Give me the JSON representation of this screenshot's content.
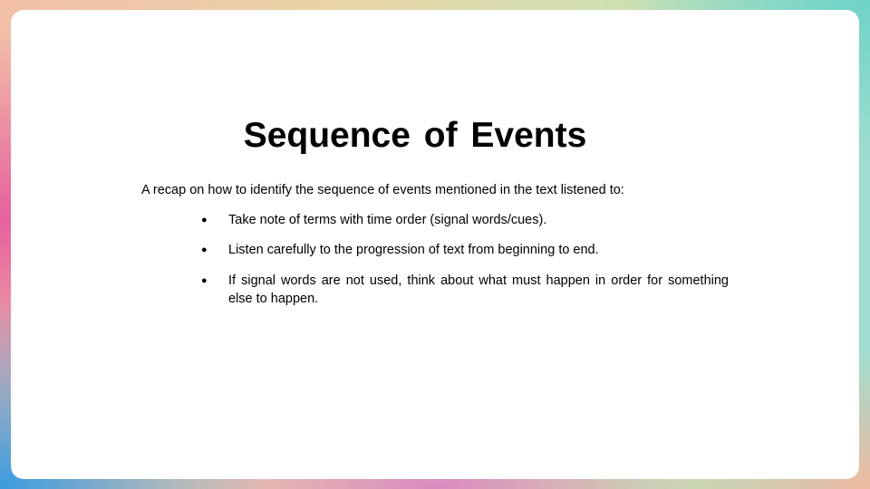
{
  "slide": {
    "title": "Sequence of Events",
    "intro": "A recap on how to identify the sequence of events mentioned in the text listened to:",
    "bullet_symbol": "●",
    "bullets": [
      "Take note of terms with time order (signal words/cues).",
      "Listen carefully to the progression of text from beginning to end.",
      "If signal words are not used, think about what must happen in order for something else to happen."
    ]
  },
  "colors": {
    "card": "#ffffff",
    "text": "#000000",
    "border_gradient": [
      "#f2c0a8",
      "#e6609e",
      "#3a9be0",
      "#6fd3c8"
    ]
  }
}
